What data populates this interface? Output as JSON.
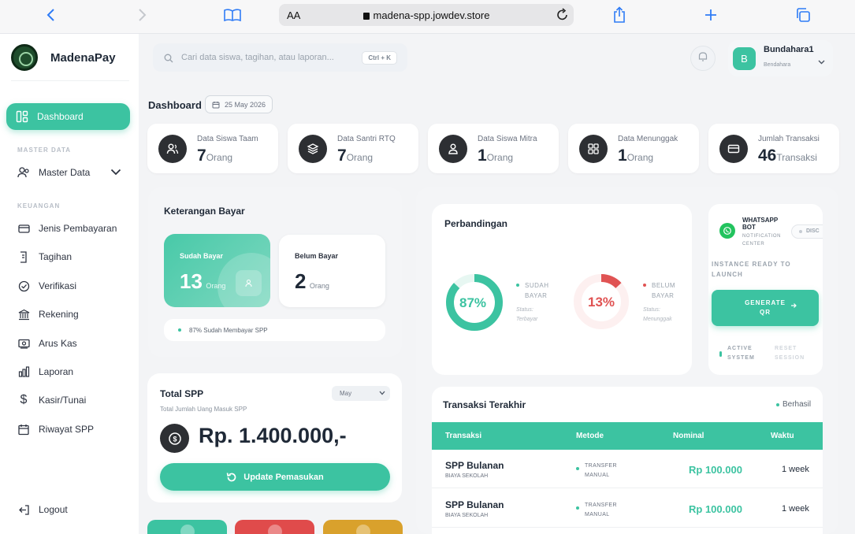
{
  "browser": {
    "text_size": "AA",
    "url": "madena-spp.jowdev.store"
  },
  "sidebar": {
    "brand": "MadenaPay",
    "dashboard": "Dashboard",
    "section_master": "MASTER DATA",
    "master_data": "Master Data",
    "section_finance": "KEUANGAN",
    "items": [
      "Jenis Pembayaran",
      "Tagihan",
      "Verifikasi",
      "Rekening",
      "Arus Kas",
      "Laporan",
      "Kasir/Tunai",
      "Riwayat SPP"
    ],
    "logout": "Logout"
  },
  "header": {
    "search_placeholder": "Cari data siswa, tagihan, atau laporan...",
    "shortcut": "Ctrl + K",
    "user_initial": "B",
    "user_name": "Bundahara1",
    "user_role": "Bendahara"
  },
  "page": {
    "title": "Dashboard",
    "date": "25 May 2026"
  },
  "stats": [
    {
      "label": "Data Siswa Taam",
      "value": "7",
      "unit": "Orang",
      "icon": "users-icon"
    },
    {
      "label": "Data Santri RTQ",
      "value": "7",
      "unit": "Orang",
      "icon": "layers-icon"
    },
    {
      "label": "Data Siswa Mitra",
      "value": "1",
      "unit": "Orang",
      "icon": "user-icon"
    },
    {
      "label": "Data Menunggak",
      "value": "1",
      "unit": "Orang",
      "icon": "grid-icon"
    },
    {
      "label": "Jumlah Transaksi",
      "value": "46",
      "unit": "Transaksi",
      "icon": "card-icon"
    }
  ],
  "keterangan": {
    "title": "Keterangan Bayar",
    "paid_label": "Sudah Bayar",
    "paid_value": "13",
    "paid_unit": "Orang",
    "unpaid_label": "Belum Bayar",
    "unpaid_value": "2",
    "unpaid_unit": "Orang",
    "note": "87% Sudah Membayar SPP"
  },
  "total_spp": {
    "title": "Total SPP",
    "subtitle": "Total Jumlah Uang Masuk SPP",
    "month": "May",
    "amount": "Rp. 1.400.000,-",
    "button": "Update Pemasukan"
  },
  "quick_colors": [
    "#3cc3a1",
    "#e04b4b",
    "#d9a12c"
  ],
  "perbandingan": {
    "title": "Perbandingan",
    "paid_percent": 87,
    "paid_label": "87%",
    "paid_legend_1": "SUDAH",
    "paid_legend_2": "BAYAR",
    "paid_status_1": "Status:",
    "paid_status_2": "Terbayar",
    "unpaid_percent": 13,
    "unpaid_label": "13%",
    "unpaid_legend_1": "BELUM",
    "unpaid_legend_2": "BAYAR",
    "unpaid_status_1": "Status:",
    "unpaid_status_2": "Menunggak",
    "paid_color": "#3cc3a1",
    "unpaid_color": "#e05353"
  },
  "whatsapp": {
    "title": "WHATSAPP BOT",
    "subtitle": "NOTIFICATION CENTER",
    "disconnect": "DISC",
    "status": "INSTANCE READY TO LAUNCH",
    "button": "GENERATE QR",
    "active": "ACTIVE SYSTEM",
    "reset": "RESET SESSION"
  },
  "transactions": {
    "title": "Transaksi Terakhir",
    "status": "Berhasil",
    "headers": [
      "Transaksi",
      "Metode",
      "Nominal",
      "Waktu"
    ],
    "rows": [
      {
        "name": "SPP Bulanan",
        "category": "BIAYA SEKOLAH",
        "method": "TRANSFER MANUAL",
        "amount": "Rp 100.000",
        "time": "1 week"
      },
      {
        "name": "SPP Bulanan",
        "category": "BIAYA SEKOLAH",
        "method": "TRANSFER MANUAL",
        "amount": "Rp 100.000",
        "time": "1 week"
      }
    ]
  }
}
